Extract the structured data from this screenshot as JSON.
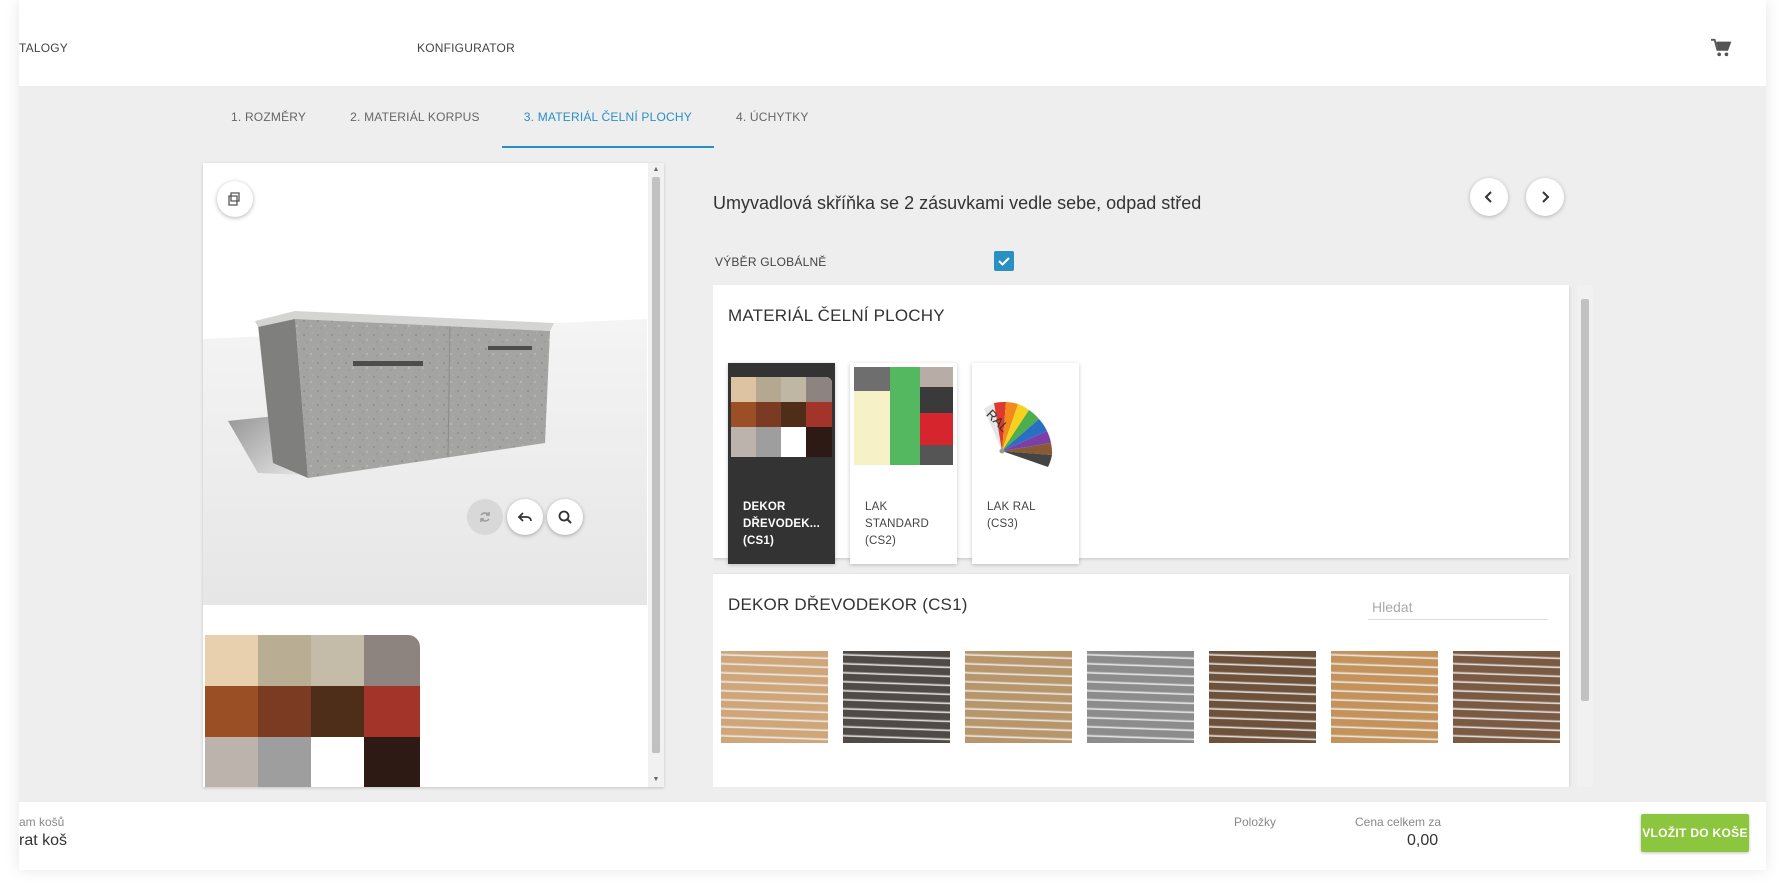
{
  "topbar": {
    "left_link": "TALOGY",
    "center_link": "KONFIGURATOR",
    "cart_icon": "cart-icon"
  },
  "tabs": [
    {
      "label": "1. ROZMĚRY",
      "active": false
    },
    {
      "label": "2. MATERIÁL KORPUS",
      "active": false
    },
    {
      "label": "3. MATERIÁL ČELNÍ PLOCHY",
      "active": true
    },
    {
      "label": "4. ÚCHYTKY",
      "active": false
    }
  ],
  "config": {
    "title": "Umyvadlová skříňka se 2 zásuvkami vedle sebe, odpad střed",
    "global_label": "VÝBĚR GLOBÁLNĚ",
    "global_checked": true
  },
  "materials_card": {
    "heading": "MATERIÁL ČELNÍ PLOCHY",
    "options": [
      {
        "line1": "DEKOR",
        "line2": "DŘEVODEK...",
        "line3": "(CS1)",
        "selected": true
      },
      {
        "line1": "LAK",
        "line2": "STANDARD",
        "line3": "(CS2)",
        "selected": false
      },
      {
        "line1": "LAK RAL",
        "line2": "(CS3)",
        "line3": "",
        "selected": false
      }
    ],
    "ral_text": "RAL"
  },
  "decor_card": {
    "heading": "DEKOR DŘEVODEKOR (CS1)",
    "search_placeholder": "Hledat",
    "tile_colors": [
      "#cfa679",
      "#4f4a45",
      "#b8966b",
      "#8c8c8c",
      "#6e513a",
      "#c4935c",
      "#7a5a43"
    ]
  },
  "footer": {
    "cart_small": "am košů",
    "cart_big": "rat koš",
    "items_label": "Položky",
    "total_label": "Cena celkem za",
    "total_value": "0,00",
    "add_button": "VLOŽIT DO KOŠE"
  },
  "colors": {
    "accent": "#2a8fc2",
    "add_button": "#8cc63f",
    "selected_card": "#333333"
  }
}
